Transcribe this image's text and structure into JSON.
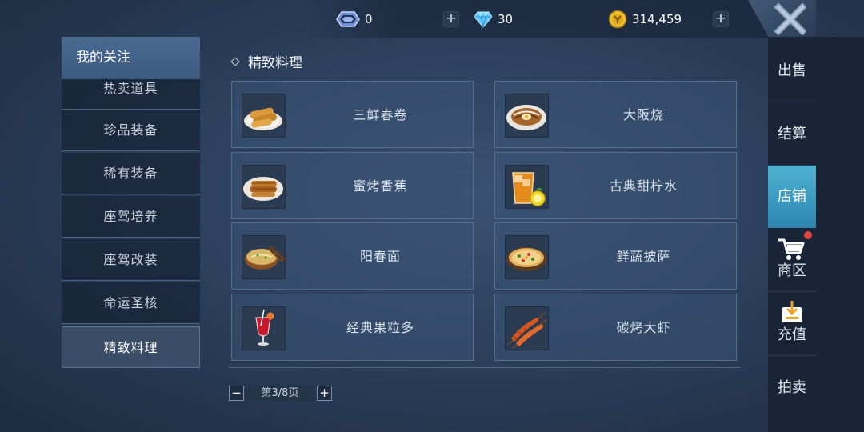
{
  "currencies": [
    {
      "icon": "crystal-icon",
      "value": "0",
      "has_plus": true
    },
    {
      "icon": "diamond-icon",
      "value": "30",
      "has_plus": false
    },
    {
      "icon": "gold-coin-icon",
      "value": "314,459",
      "has_plus": true
    }
  ],
  "categories": {
    "header": "我的关注",
    "items": [
      {
        "label": "热卖道具",
        "active": false
      },
      {
        "label": "珍品装备",
        "active": false
      },
      {
        "label": "稀有装备",
        "active": false
      },
      {
        "label": "座驾培养",
        "active": false
      },
      {
        "label": "座驾改装",
        "active": false
      },
      {
        "label": "命运圣核",
        "active": false
      },
      {
        "label": "精致料理",
        "active": true
      }
    ]
  },
  "section_title": "精致料理",
  "items": [
    {
      "name": "三鲜春卷",
      "icon": "spring-roll-icon"
    },
    {
      "name": "大阪烧",
      "icon": "okonomiyaki-icon"
    },
    {
      "name": "蜜烤香蕉",
      "icon": "roasted-banana-icon"
    },
    {
      "name": "古典甜柠水",
      "icon": "lemonade-icon"
    },
    {
      "name": "阳春面",
      "icon": "noodle-soup-icon"
    },
    {
      "name": "鲜蔬披萨",
      "icon": "pizza-icon"
    },
    {
      "name": "经典果粒多",
      "icon": "fruit-cocktail-icon"
    },
    {
      "name": "碳烤大虾",
      "icon": "grilled-shrimp-icon"
    }
  ],
  "pager": {
    "minus": "−",
    "label": "第3/8页",
    "plus": "+"
  },
  "side_tabs": [
    {
      "label": "出售",
      "active": false
    },
    {
      "label": "结算",
      "active": false
    },
    {
      "label": "店铺",
      "active": true
    },
    {
      "label": "商区",
      "active": false,
      "icon": "cart-icon",
      "badge": true
    },
    {
      "label": "充值",
      "active": false,
      "icon": "recharge-icon"
    },
    {
      "label": "拍卖",
      "active": false
    }
  ],
  "colors": {
    "accent": "#3aa3cc",
    "badge": "#e2453f",
    "gold": "#f2c230",
    "diamond": "#5ec8ff"
  }
}
